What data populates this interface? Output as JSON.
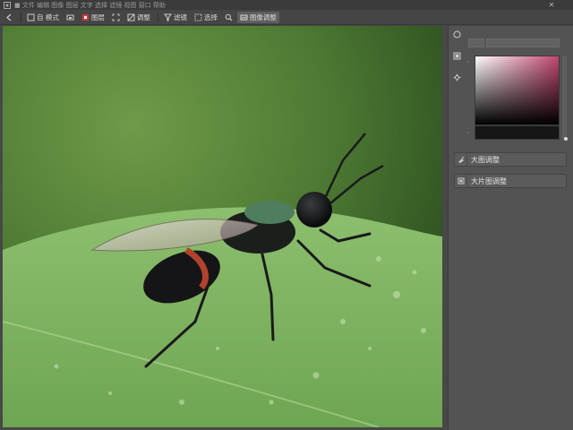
{
  "window": {
    "title": "■ 文件 编辑 图像 图层 文字 选择 滤镜 视图 窗口 帮助",
    "close_label": "✕"
  },
  "toolbar": {
    "items": [
      {
        "label": "",
        "icon": "back-arrow-icon"
      },
      {
        "label": "自 模式",
        "icon": "auto-mode-icon"
      },
      {
        "label": "",
        "icon": "layer-icon"
      },
      {
        "label": "图层",
        "icon": "red-layer-icon"
      },
      {
        "label": "",
        "icon": "frame-icon"
      },
      {
        "label": "调整",
        "icon": "adjust-icon"
      },
      {
        "label": "滤镜",
        "icon": "filter-icon"
      },
      {
        "label": "选择",
        "icon": "select-icon"
      },
      {
        "label": "",
        "icon": "zoom-icon"
      },
      {
        "label": "图像调整",
        "icon": "image-adjust-icon"
      }
    ]
  },
  "panel": {
    "side_icons": [
      "histogram-icon",
      "color-icon",
      "settings-icon"
    ],
    "rows": [
      {
        "label": "大图调整",
        "icon": "brush-icon"
      },
      {
        "label": "大片图调整",
        "icon": "layer-stack-icon"
      }
    ]
  },
  "colors": {
    "picker_hue": "#c0456f",
    "background": "#484848",
    "panel": "#535353"
  }
}
